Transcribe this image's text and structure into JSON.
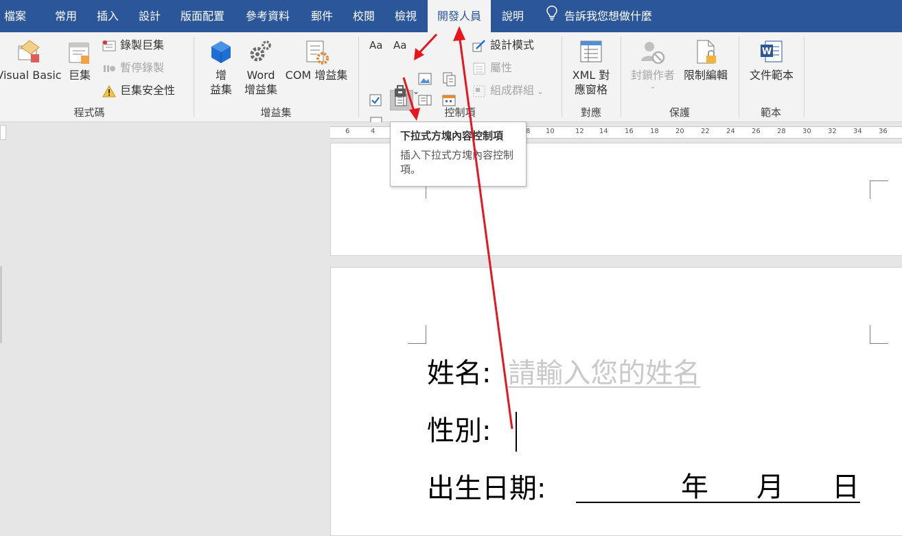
{
  "tabs": [
    {
      "label": "檔案"
    },
    {
      "label": "常用"
    },
    {
      "label": "插入"
    },
    {
      "label": "設計"
    },
    {
      "label": "版面配置"
    },
    {
      "label": "參考資料"
    },
    {
      "label": "郵件"
    },
    {
      "label": "校閱"
    },
    {
      "label": "檢視"
    },
    {
      "label": "開發人員",
      "active": true
    },
    {
      "label": "說明"
    }
  ],
  "tell_me": "告訴我您想做什麼",
  "ribbon": {
    "code": {
      "label": "程式碼",
      "visual_basic": "Visual Basic",
      "macros": "巨集",
      "record_macro": "錄製巨集",
      "pause_recording": "暫停錄製",
      "macro_security": "巨集安全性"
    },
    "addins": {
      "label": "增益集",
      "addins_line1": "增",
      "addins_line2": "益集",
      "word_line1": "Word",
      "word_line2": "增益集",
      "com": "COM 增益集"
    },
    "controls": {
      "label": "控制項",
      "aa1": "Aa",
      "aa2": "Aa",
      "design_mode": "設計模式",
      "properties": "屬性",
      "group": "組成群組"
    },
    "mapping": {
      "label": "對應",
      "xml_line1": "XML 對",
      "xml_line2": "應窗格"
    },
    "protect": {
      "label": "保護",
      "block_authors": "封鎖作者",
      "restrict_editing": "限制編輯"
    },
    "templates": {
      "label": "範本",
      "document_template": "文件範本"
    }
  },
  "ruler": {
    "numbers": [
      "6",
      "4",
      "8",
      "10",
      "12",
      "14",
      "16",
      "18",
      "20",
      "22",
      "24",
      "26",
      "28",
      "30",
      "32",
      "34",
      "36"
    ]
  },
  "tooltip": {
    "title": "下拉式方塊內容控制項",
    "description": "插入下拉式方塊內容控制項。"
  },
  "document": {
    "name_label": "姓名:",
    "name_placeholder": "請輸入您的姓名",
    "gender_label": "性別:",
    "birth_label": "出生日期:",
    "year": "年",
    "month": "月",
    "day": "日"
  },
  "colors": {
    "accent": "#2b579a",
    "arrow": "#e8141e"
  }
}
